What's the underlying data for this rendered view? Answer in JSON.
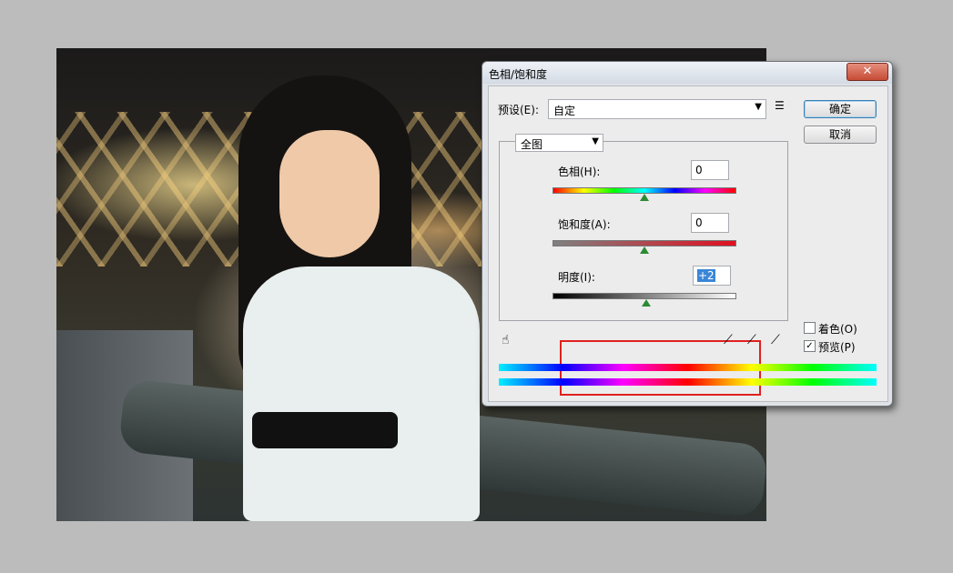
{
  "window": {
    "title": "色相/饱和度",
    "close_glyph": "✕"
  },
  "preset": {
    "label": "预设(E):",
    "value": "自定",
    "menu_icon": "preset-options-icon"
  },
  "buttons": {
    "ok": "确定",
    "cancel": "取消"
  },
  "channel": {
    "value": "全图"
  },
  "hue": {
    "label": "色相(H):",
    "value": "0",
    "level": 0.5
  },
  "saturation": {
    "label": "饱和度(A):",
    "value": "0",
    "level": 0.5
  },
  "lightness": {
    "label": "明度(I):",
    "value": "+2",
    "level": 0.51
  },
  "options": {
    "colorize_label": "着色(O)",
    "colorize_checked": false,
    "preview_label": "预览(P)",
    "preview_checked": true,
    "check_mark": "✓"
  },
  "icons": {
    "hand_tool": "target-adjust-icon",
    "eyedroppers": [
      "eyedropper-icon",
      "eyedropper-plus-icon",
      "eyedropper-minus-icon"
    ]
  },
  "colors": {
    "highlight_box": "#e02020",
    "selection": "#3b86d6"
  }
}
